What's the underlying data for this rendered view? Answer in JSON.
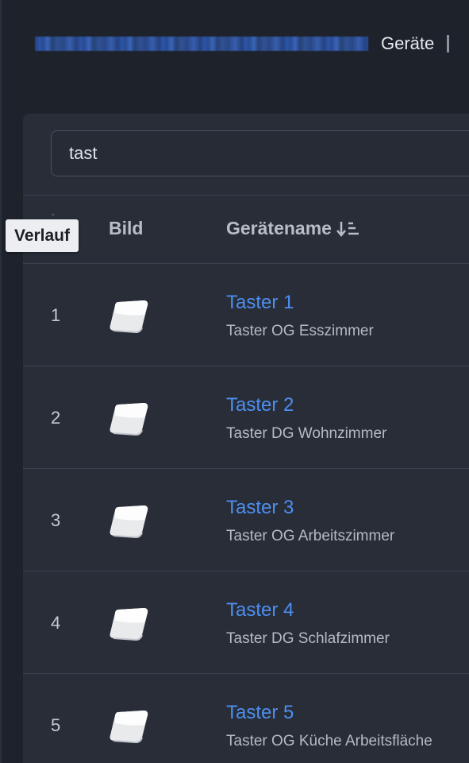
{
  "breadcrumb": {
    "current": "Geräte"
  },
  "search": {
    "value": "tast"
  },
  "table": {
    "headers": {
      "image": "Bild",
      "name": "Gerätename"
    },
    "rows": [
      {
        "index": "1",
        "name": "Taster 1",
        "description": "Taster OG Esszimmer"
      },
      {
        "index": "2",
        "name": "Taster 2",
        "description": "Taster DG Wohnzimmer"
      },
      {
        "index": "3",
        "name": "Taster 3",
        "description": "Taster OG Arbeitszimmer"
      },
      {
        "index": "4",
        "name": "Taster 4",
        "description": "Taster DG Schlafzimmer"
      },
      {
        "index": "5",
        "name": "Taster 5",
        "description": "Taster OG Küche Arbeitsfläche"
      }
    ]
  },
  "tooltip": {
    "text": "Verlauf"
  },
  "icons": {
    "sort": "sort-descending-icon",
    "device": "button-device-icon"
  },
  "colors": {
    "background": "#1e222b",
    "card": "#282d38",
    "link": "#4d8ff0"
  }
}
